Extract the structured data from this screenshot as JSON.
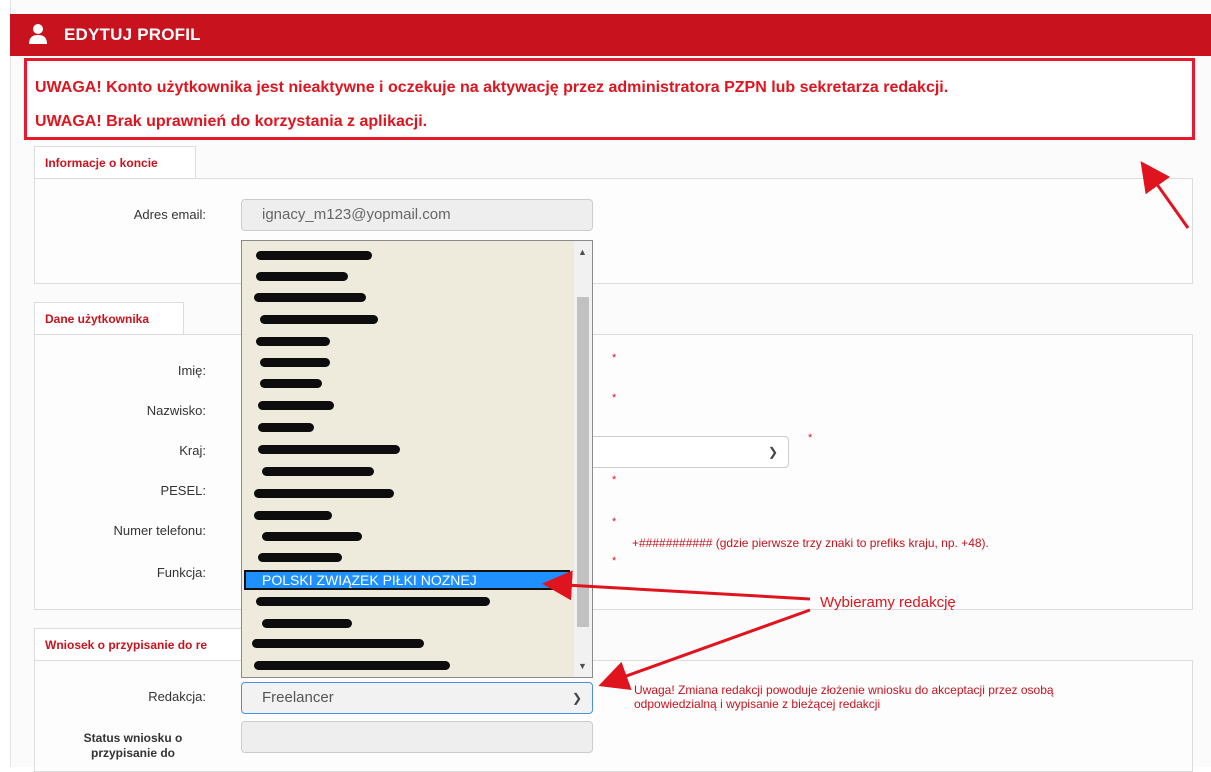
{
  "header": {
    "title": "EDYTUJ PROFIL",
    "icon": "user-icon"
  },
  "alerts": [
    "UWAGA! Konto użytkownika jest nieaktywne i oczekuje na aktywację przez administratora PZPN lub sekretarza redakcji.",
    "UWAGA! Brak uprawnień do korzystania z aplikacji."
  ],
  "account": {
    "tab_label": "Informacje o koncie",
    "email_label": "Adres email:",
    "email_value": "ignacy_m123@yopmail.com"
  },
  "user": {
    "tab_label": "Dane użytkownika",
    "first_name_label": "Imię:",
    "last_name_label": "Nazwisko:",
    "country_label": "Kraj:",
    "pesel_label": "PESEL:",
    "phone_label": "Numer telefonu:",
    "phone_hint": "+########### (gdzie pierwsze trzy znaki to prefiks kraju, np. +48).",
    "function_label": "Funkcja:",
    "required_marker": "*"
  },
  "request": {
    "tab_label": "Wniosek o przypisanie do re",
    "redakcja_label": "Redakcja:",
    "redakcja_value": "Freelancer",
    "redakcja_warning_line1": "Uwaga! Zmiana redakcji powoduje złożenie wniosku do akceptacji przez osobą",
    "redakcja_warning_line2": "odpowiedzialną i wypisanie z bieżącej redakcji",
    "status_label_line1": "Status wniosku o",
    "status_label_line2": "przypisanie do",
    "status_value": ""
  },
  "dropdown": {
    "selected_option": "POLSKI ZWIĄZEK PIŁKI NOZNEJ",
    "redacted_option_count": 19
  },
  "annotations": {
    "callout": "Wybieramy redakcję"
  },
  "colors": {
    "brand_red": "#c8121d",
    "alert_red": "#e0141e",
    "selection_blue": "#1e90ff",
    "dropdown_bg": "#efebdc"
  }
}
